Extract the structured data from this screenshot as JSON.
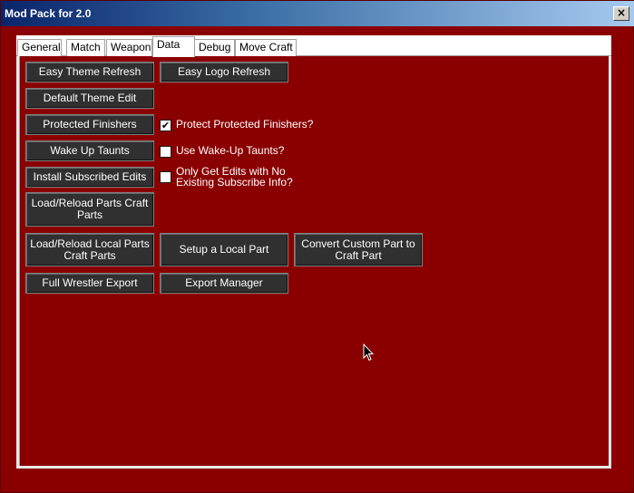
{
  "window": {
    "title": "Mod Pack for 2.0"
  },
  "tabs": [
    {
      "label": "General",
      "active": false
    },
    {
      "label": "Match",
      "active": false
    },
    {
      "label": "Weapon",
      "active": false
    },
    {
      "label": "Data",
      "active": true
    },
    {
      "label": "Debug",
      "active": false
    },
    {
      "label": "Move Craft",
      "active": false
    }
  ],
  "buttons": {
    "easy_theme_refresh": "Easy Theme Refresh",
    "easy_logo_refresh": "Easy Logo Refresh",
    "default_theme_edit": "Default Theme Edit",
    "protected_finishers": "Protected Finishers",
    "wake_up_taunts": "Wake Up Taunts",
    "install_subscribed_edits": "Install Subscribed Edits",
    "load_reload_parts_craft_parts": "Load/Reload Parts Craft Parts",
    "load_reload_local_parts_craft_parts": "Load/Reload Local Parts Craft Parts",
    "setup_local_part": "Setup a Local Part",
    "convert_custom_part": "Convert Custom Part to Craft Part",
    "full_wrestler_export": "Full Wrestler Export",
    "export_manager": "Export Manager"
  },
  "checkboxes": {
    "protect_finishers": {
      "label": "Protect Protected Finishers?",
      "checked": true
    },
    "use_wakeup_taunts": {
      "label": "Use Wake-Up Taunts?",
      "checked": false
    },
    "only_get_edits": {
      "label": "Only Get Edits with No\nExisting Subscribe Info?",
      "checked": false
    }
  },
  "colors": {
    "panel_background": "#8a0000",
    "button_background": "#303030",
    "title_gradient_start": "#0a246a"
  },
  "icons": {
    "close": "close-icon",
    "check": "check-icon",
    "cursor": "mouse-cursor-icon"
  }
}
